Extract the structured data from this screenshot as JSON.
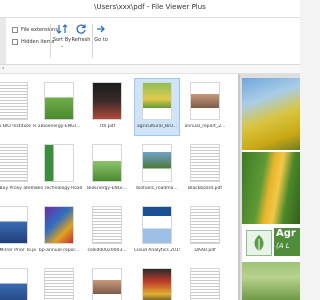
{
  "window": {
    "title": "\\Users\\xxx\\pdf - File Viewer Plus"
  },
  "ribbon": {
    "file_extensions_label": "File extensions",
    "hidden_items_label": "Hidden items",
    "sort_by_label": "Sort By",
    "refresh_label": "Refresh",
    "go_to_label": "Go to"
  },
  "files": [
    {
      "name": "2016 BIO Institute Te...",
      "kind": "text"
    },
    {
      "name": "2Bioenergy-ENGl...",
      "kind": "green"
    },
    {
      "name": "7th.pdf",
      "kind": "dark"
    },
    {
      "name": "agricultural_BiO...",
      "kind": "agri",
      "selected": true
    },
    {
      "name": "annual_report_2...",
      "kind": "people"
    },
    {
      "name": "ced Buy Proxy atement.pdf",
      "kind": "text"
    },
    {
      "name": "Bio Technology Roadmap.pdf",
      "kind": "greenstripe"
    },
    {
      "name": "BioEnergy-ENGl...",
      "kind": "green2"
    },
    {
      "name": "biofuels_roadma...",
      "kind": "landscape"
    },
    {
      "name": "Blackboard.pdf",
      "kind": "text"
    },
    {
      "name": "nce Mirror Prior To.pdf",
      "kind": "blue"
    },
    {
      "name": "bp-annual-repor...",
      "kind": "colorful"
    },
    {
      "name": "cellid00020003...",
      "kind": "text"
    },
    {
      "name": "Cloud Analytics 2015.pdf",
      "kind": "bluedoc"
    },
    {
      "name": "DAAR.pdf",
      "kind": "text"
    },
    {
      "name": "",
      "kind": "blue"
    },
    {
      "name": "",
      "kind": "text"
    },
    {
      "name": "",
      "kind": "people"
    },
    {
      "name": "",
      "kind": "magazine"
    },
    {
      "name": "",
      "kind": "text"
    }
  ],
  "preview": {
    "banner_title": "Agr",
    "banner_sub": "(A L"
  }
}
